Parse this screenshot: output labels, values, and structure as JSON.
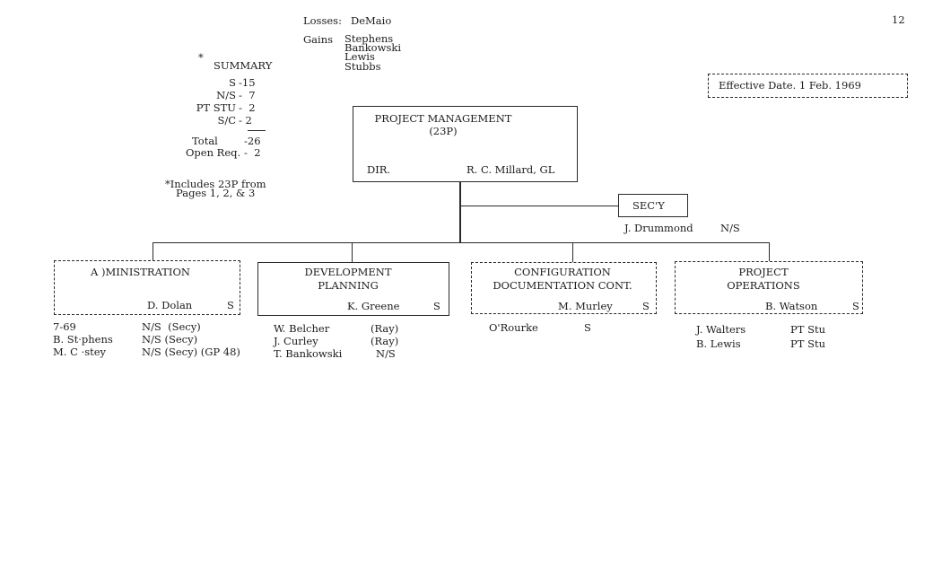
{
  "page_number": "12",
  "changes": {
    "losses_label": "Losses:",
    "losses": [
      "DeMaio"
    ],
    "gains_label": "Gains",
    "gains": [
      "Stephens",
      "Bankowski",
      "Lewis",
      "Stubbs"
    ]
  },
  "summary": {
    "asterisk": "*",
    "title": "SUMMARY",
    "rows": [
      {
        "label": "S",
        "value": "-15"
      },
      {
        "label": "N/S",
        "value": "-  7"
      },
      {
        "label": "PT STU",
        "value": "-  2"
      },
      {
        "label": "S/C",
        "value": "- 2"
      }
    ],
    "total_label": "Total",
    "total_value": "-26",
    "open_req_label": "Open Req.",
    "open_req_value": "-  2",
    "footnote_line1": "*Includes 23P from",
    "footnote_line2": "Pages 1, 2, & 3"
  },
  "effective_date": "Effective Date.  1 Feb. 1969",
  "head_unit": {
    "title": "PROJECT MANAGEMENT",
    "subtitle": "(23P)",
    "role": "DIR.",
    "manager": "R. C.  Millard,  GL"
  },
  "secretary": {
    "title": "SEC'Y",
    "name": "J.  Drummond",
    "status": "N/S"
  },
  "departments": [
    {
      "title_line1": "A )MINISTRATION",
      "title_line2": "",
      "manager": "D.  Dolan",
      "manager_status": "S",
      "staff": [
        {
          "name": "7-69",
          "status": "N/S  (Secy)"
        },
        {
          "name": "B.  St·phens",
          "status": "N/S (Secy)"
        },
        {
          "name": "M.  C ·stey",
          "status": "N/S (Secy) (GP 48)"
        }
      ]
    },
    {
      "title_line1": "DEVELOPMENT",
      "title_line2": "PLANNING",
      "manager": "K.  Greene",
      "manager_status": "S",
      "staff": [
        {
          "name": "W.  Belcher",
          "status": "(Ray)"
        },
        {
          "name": "J.  Curley",
          "status": "(Ray)"
        },
        {
          "name": "T.  Bankowski",
          "status": "N/S"
        }
      ]
    },
    {
      "title_line1": "CONFIGURATION",
      "title_line2": "DOCUMENTATION CONT.",
      "manager": "M.  Murley",
      "manager_status": "S",
      "staff": [
        {
          "name": "O'Rourke",
          "status": "S"
        }
      ]
    },
    {
      "title_line1": "PROJECT",
      "title_line2": "OPERATIONS",
      "manager": "B.  Watson",
      "manager_status": "S",
      "staff": [
        {
          "name": "J.  Walters",
          "status": "PT Stu"
        },
        {
          "name": "B.  Lewis",
          "status": "PT Stu"
        }
      ]
    }
  ]
}
